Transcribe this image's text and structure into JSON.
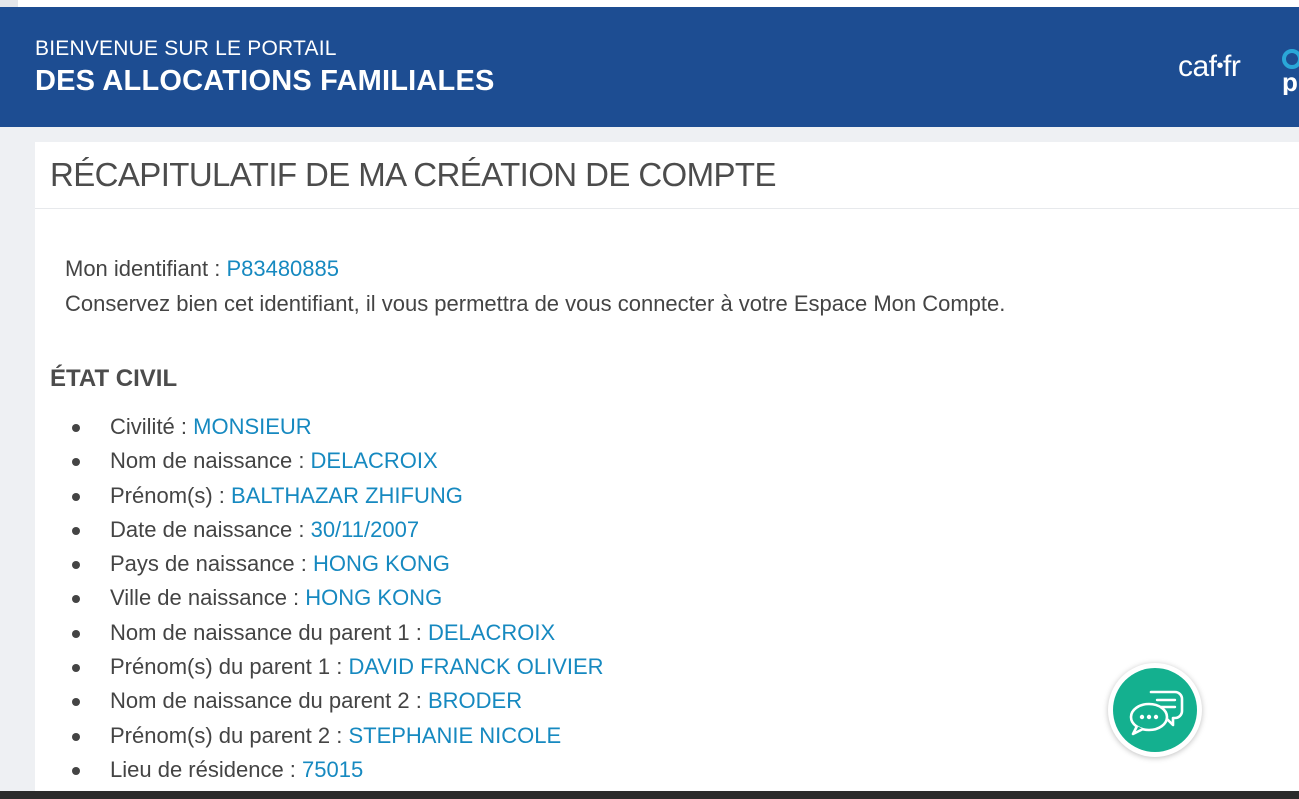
{
  "header": {
    "welcome": "BIENVENUE SUR LE PORTAIL",
    "portal": "DES ALLOCATIONS FAMILIALES",
    "logo_left": "caf",
    "logo_dot": "•",
    "logo_right": "fr",
    "partial_logo_char": "p"
  },
  "card": {
    "title": "RÉCAPITULATIF DE MA CRÉATION DE COMPTE",
    "identifier_label": "Mon identifiant : ",
    "identifier_value": "P83480885",
    "identifier_note": "Conservez bien cet identifiant, il vous permettra de vous connecter à votre Espace Mon Compte.",
    "section_title": "ÉTAT CIVIL",
    "items": [
      {
        "label": "Civilité : ",
        "value": "MONSIEUR"
      },
      {
        "label": "Nom de naissance : ",
        "value": "DELACROIX"
      },
      {
        "label": "Prénom(s) : ",
        "value": "BALTHAZAR ZHIFUNG"
      },
      {
        "label": "Date de naissance : ",
        "value": "30/11/2007"
      },
      {
        "label": "Pays de naissance : ",
        "value": "HONG KONG"
      },
      {
        "label": "Ville de naissance : ",
        "value": "HONG KONG"
      },
      {
        "label": "Nom de naissance du parent 1 : ",
        "value": "DELACROIX"
      },
      {
        "label": "Prénom(s) du parent 1 : ",
        "value": "DAVID FRANCK OLIVIER"
      },
      {
        "label": "Nom de naissance du parent 2 : ",
        "value": "BRODER"
      },
      {
        "label": "Prénom(s) du parent 2 : ",
        "value": "STEPHANIE NICOLE"
      },
      {
        "label": "Lieu de résidence : ",
        "value": "75015"
      }
    ]
  },
  "chat": {
    "icon": "chat-bubbles-icon"
  },
  "colors": {
    "header_bg": "#1d4d92",
    "value_text": "#1689c0",
    "chat_bg": "#14b08f"
  }
}
